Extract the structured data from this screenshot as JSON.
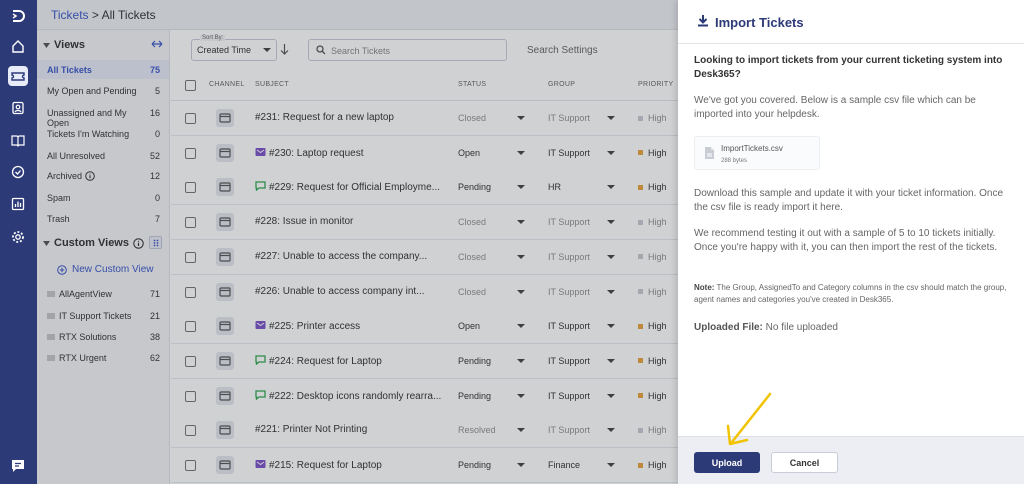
{
  "breadcrumb": {
    "parent": "Tickets",
    "separator": " > ",
    "current": "All Tickets"
  },
  "views_panel": {
    "header": "Views",
    "items": [
      {
        "label": "All Tickets",
        "count": "75"
      },
      {
        "label": "My Open and Pending",
        "count": "5"
      },
      {
        "label": "Unassigned and My Open",
        "count": "16"
      },
      {
        "label": "Tickets I'm Watching",
        "count": "0"
      },
      {
        "label": "All Unresolved",
        "count": "52"
      },
      {
        "label": "Archived",
        "count": "12"
      },
      {
        "label": "Spam",
        "count": "0"
      },
      {
        "label": "Trash",
        "count": "7"
      }
    ],
    "custom_header": "Custom Views",
    "new_custom_view": "New Custom View",
    "custom_items": [
      {
        "label": "AllAgentView",
        "count": "71"
      },
      {
        "label": "IT Support Tickets",
        "count": "21"
      },
      {
        "label": "RTX Solutions",
        "count": "38"
      },
      {
        "label": "RTX Urgent",
        "count": "62"
      }
    ]
  },
  "toolbar": {
    "sort_label": "Sort By:",
    "sort_value": "Created Time",
    "search_placeholder": "Search Tickets",
    "search_settings": "Search Settings"
  },
  "columns": {
    "channel": "CHANNEL",
    "subject": "SUBJECT",
    "status": "STATUS",
    "group": "GROUP",
    "priority": "PRIORITY"
  },
  "tickets": [
    {
      "channel": "portal",
      "subject": "#231: Request for a new laptop",
      "status": "Closed",
      "group": "IT Support",
      "priority": "High",
      "priority_color": "#9aa0aa",
      "dim": true
    },
    {
      "channel": "email",
      "subject": "#230: Laptop request",
      "status": "Open",
      "group": "IT Support",
      "priority": "High",
      "priority_color": "#e8a33d",
      "dim": false
    },
    {
      "channel": "chat",
      "subject": "#229: Request for Official Employme...",
      "status": "Pending",
      "group": "HR",
      "priority": "High",
      "priority_color": "#e8a33d",
      "dim": false
    },
    {
      "channel": "portal",
      "subject": "#228: Issue in monitor",
      "status": "Closed",
      "group": "IT Support",
      "priority": "High",
      "priority_color": "#9aa0aa",
      "dim": true
    },
    {
      "channel": "portal",
      "subject": "#227: Unable to access the company...",
      "status": "Closed",
      "group": "IT Support",
      "priority": "High",
      "priority_color": "#9aa0aa",
      "dim": true
    },
    {
      "channel": "portal",
      "subject": "#226: Unable to access company int...",
      "status": "Closed",
      "group": "IT Support",
      "priority": "High",
      "priority_color": "#9aa0aa",
      "dim": true
    },
    {
      "channel": "email",
      "subject": "#225: Printer access",
      "status": "Open",
      "group": "IT Support",
      "priority": "High",
      "priority_color": "#e8a33d",
      "dim": false
    },
    {
      "channel": "chat",
      "subject": "#224: Request for Laptop",
      "status": "Pending",
      "group": "IT Support",
      "priority": "High",
      "priority_color": "#e8a33d",
      "dim": false
    },
    {
      "channel": "chat",
      "subject": "#222: Desktop icons randomly rearra...",
      "status": "Pending",
      "group": "IT Support",
      "priority": "High",
      "priority_color": "#e8a33d",
      "dim": false
    },
    {
      "channel": "portal",
      "subject": "#221: Printer Not Printing",
      "status": "Resolved",
      "group": "IT Support",
      "priority": "High",
      "priority_color": "#9aa0aa",
      "dim": true
    },
    {
      "channel": "email",
      "subject": "#215: Request for Laptop",
      "status": "Pending",
      "group": "Finance",
      "priority": "High",
      "priority_color": "#e8a33d",
      "dim": false
    }
  ],
  "import_panel": {
    "title": "Import Tickets",
    "intro": "Looking to import tickets from your current ticketing system into Desk365?",
    "covered": "We've got you covered. Below is a sample csv file which can be imported into your helpdesk.",
    "file_name": "ImportTickets.csv",
    "file_size": "288 bytes",
    "download_text": "Download this sample and update it with your ticket information. Once the csv file is ready import it here.",
    "recommend_text": "We recommend testing it out with a sample of 5 to 10 tickets initially. Once you're happy with it, you can then import the rest of the tickets.",
    "note_label": "Note:",
    "note_text": " The Group, AssignedTo and Category columns in the csv should match the group, agent names and categories you've created in Desk365.",
    "uploaded_label": "Uploaded File:",
    "uploaded_value": " No file uploaded",
    "upload_button": "Upload",
    "cancel_button": "Cancel"
  },
  "colors": {
    "brand": "#2d3a78",
    "link": "#3b58c8",
    "arrow": "#f2c300"
  }
}
